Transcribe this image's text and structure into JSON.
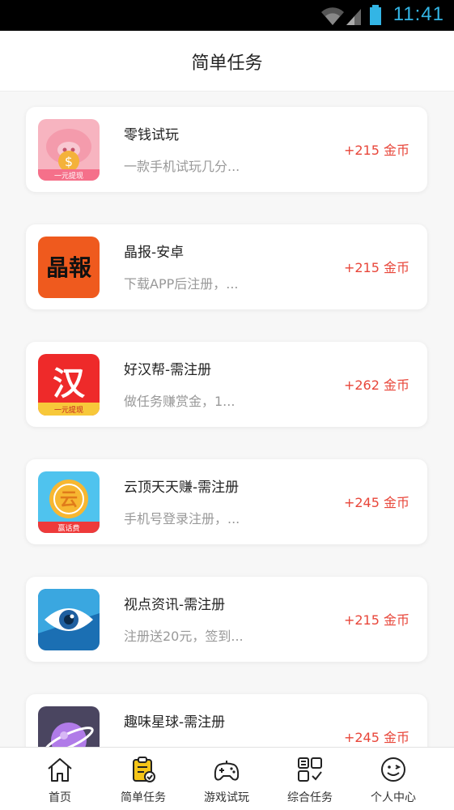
{
  "statusbar": {
    "time": "11:41"
  },
  "header": {
    "title": "简单任务"
  },
  "tasks": [
    {
      "name": "零钱试玩",
      "desc": "一款手机试玩几分...",
      "reward": "+215 金币",
      "icon": "piggy-bank-icon",
      "icon_badge": "一元提现"
    },
    {
      "name": "晶报-安卓",
      "desc": "下载APP后注册，...",
      "reward": "+215 金币",
      "icon": "jingbao-logo-icon",
      "icon_text": "晶報"
    },
    {
      "name": "好汉帮-需注册",
      "desc": "做任务赚赏金，1...",
      "reward": "+262 金币",
      "icon": "haohanbang-logo-icon",
      "icon_text": "汉",
      "icon_badge": "一元提现"
    },
    {
      "name": "云顶天天赚-需注册",
      "desc": "手机号登录注册，...",
      "reward": "+245 金币",
      "icon": "yunding-logo-icon",
      "icon_text": "云",
      "icon_badge": "赢话费"
    },
    {
      "name": "视点资讯-需注册",
      "desc": "注册送20元，签到...",
      "reward": "+215 金币",
      "icon": "eye-logo-icon"
    },
    {
      "name": "趣味星球-需注册",
      "desc": "",
      "reward": "+245 金币",
      "icon": "planet-logo-icon"
    }
  ],
  "tabbar": {
    "active_color": "#f5c518",
    "items": [
      {
        "label": "首页",
        "icon": "home-icon"
      },
      {
        "label": "简单任务",
        "icon": "task-clipboard-icon",
        "active": true
      },
      {
        "label": "游戏试玩",
        "icon": "gamepad-icon"
      },
      {
        "label": "综合任务",
        "icon": "grid-checklist-icon"
      },
      {
        "label": "个人中心",
        "icon": "smiley-face-icon"
      }
    ]
  },
  "colors": {
    "reward": "#e8463a",
    "time": "#33b5e5"
  }
}
